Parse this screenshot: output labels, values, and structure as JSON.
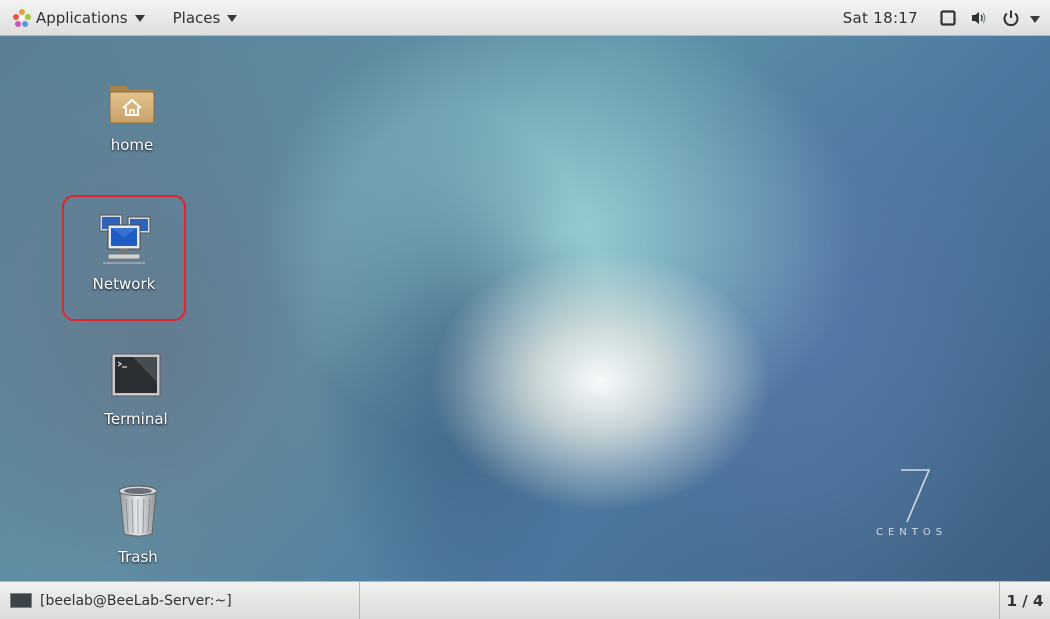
{
  "top_panel": {
    "applications_label": "Applications",
    "places_label": "Places",
    "clock": "Sat 18:17",
    "icons": [
      "screen-icon",
      "volume-icon",
      "power-icon"
    ]
  },
  "desktop": {
    "icons": [
      {
        "name": "home-folder-icon",
        "label": "home"
      },
      {
        "name": "network-icon",
        "label": "Network"
      },
      {
        "name": "terminal-icon",
        "label": "Terminal"
      },
      {
        "name": "trash-icon",
        "label": "Trash"
      }
    ],
    "selected_icon": "Network",
    "highlight_color": "#e0252f",
    "wallpaper_logo": {
      "number": "7",
      "word": "CENTOS"
    }
  },
  "bottom_panel": {
    "task_label": "[beelab@BeeLab-Server:~]",
    "workspace": "1 / 4"
  }
}
